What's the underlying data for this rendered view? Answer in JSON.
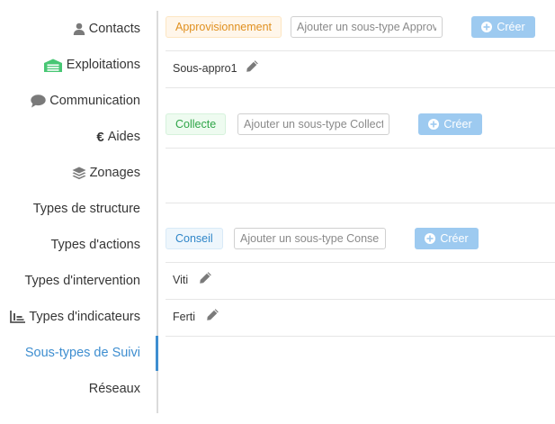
{
  "sidebar": {
    "items": [
      {
        "label": "Contacts",
        "icon": "user-icon"
      },
      {
        "label": "Exploitations",
        "icon": "barn-icon"
      },
      {
        "label": "Communication",
        "icon": "comment-icon"
      },
      {
        "label": "Aides",
        "icon": "euro-icon"
      },
      {
        "label": "Zonages",
        "icon": "layers-icon"
      },
      {
        "label": "Types de structure"
      },
      {
        "label": "Types d'actions"
      },
      {
        "label": "Types d'intervention"
      },
      {
        "label": "Types d'indicateurs",
        "icon": "chart-icon"
      },
      {
        "label": "Sous-types de Suivi",
        "active": true
      },
      {
        "label": "Réseaux"
      }
    ]
  },
  "groups": [
    {
      "tag": "Approvisionnement",
      "placeholder": "Ajouter un sous-type Approvisionnement",
      "button": "Créer",
      "items": [
        "Sous-appro1"
      ]
    },
    {
      "tag": "Collecte",
      "placeholder": "Ajouter un sous-type Collecte",
      "button": "Créer",
      "items": []
    },
    {
      "tag": "Conseil",
      "placeholder": "Ajouter un sous-type Conseil",
      "button": "Créer",
      "items": [
        "Viti",
        "Ferti"
      ]
    }
  ],
  "colors": {
    "accent": "#3e8ed0",
    "button": "#9dcaf0",
    "orange_tag": "#e0901f",
    "green_tag": "#2fa548",
    "blue_tag": "#2f86c8",
    "barn_icon": "#48c774"
  }
}
